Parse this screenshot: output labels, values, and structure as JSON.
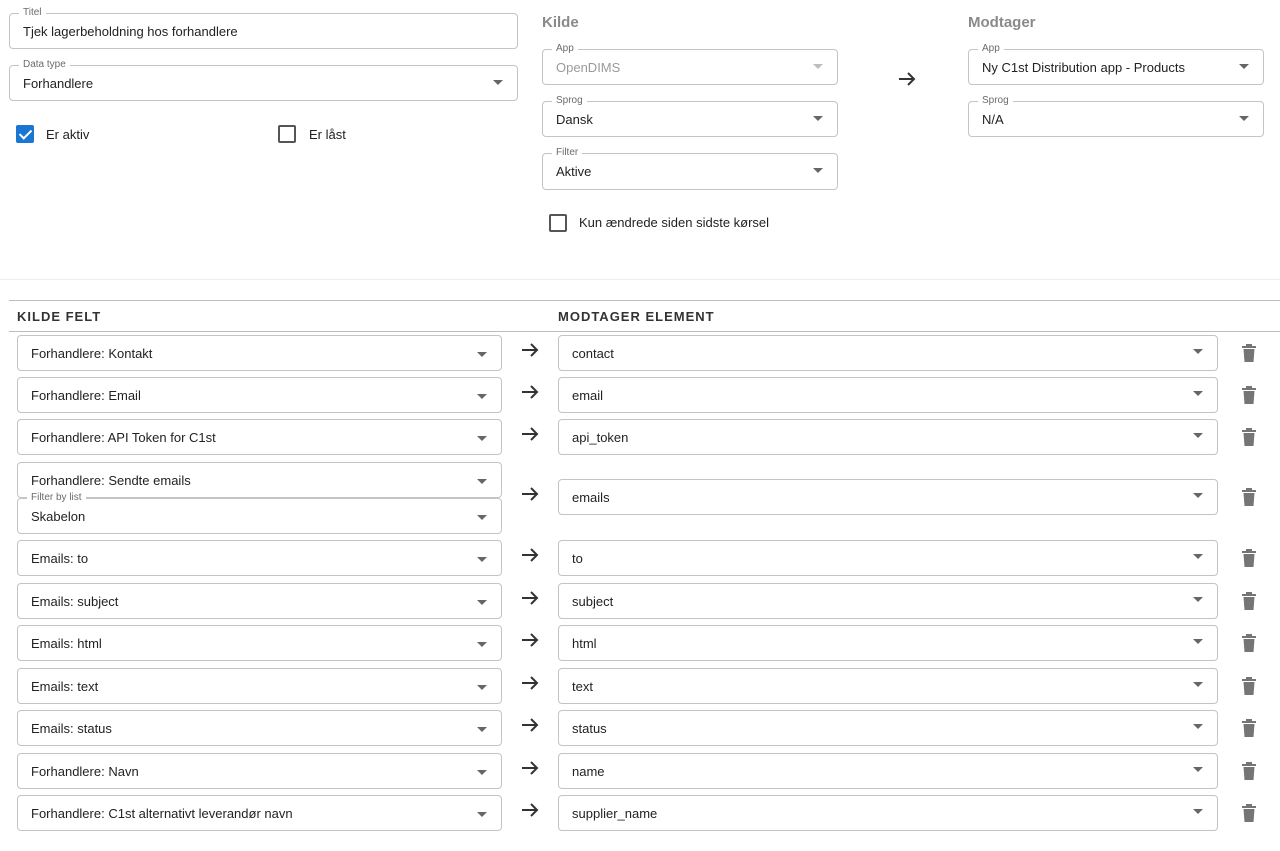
{
  "form": {
    "title_label": "Titel",
    "title_value": "Tjek lagerbeholdning hos forhandlere",
    "datatype_label": "Data type",
    "datatype_value": "Forhandlere",
    "active_label": "Er aktiv",
    "active_checked": true,
    "locked_label": "Er låst",
    "locked_checked": false
  },
  "source": {
    "heading": "Kilde",
    "app_label": "App",
    "app_value": "OpenDIMS",
    "lang_label": "Sprog",
    "lang_value": "Dansk",
    "filter_label": "Filter",
    "filter_value": "Aktive",
    "changed_only_label": "Kun ændrede siden sidste kørsel",
    "changed_only_checked": false
  },
  "receiver": {
    "heading": "Modtager",
    "app_label": "App",
    "app_value": "Ny C1st Distribution app - Products",
    "lang_label": "Sprog",
    "lang_value": "N/A"
  },
  "mapping": {
    "source_header": "KILDE FELT",
    "target_header": "MODTAGER ELEMENT",
    "filter_by_list_label": "Filter by list",
    "filter_by_list_value": "Skabelon",
    "rows": [
      {
        "source": "Forhandlere: Kontakt",
        "target": "contact"
      },
      {
        "source": "Forhandlere: Email",
        "target": "email"
      },
      {
        "source": "Forhandlere: API Token for C1st",
        "target": "api_token"
      },
      {
        "source": "Forhandlere: Sendte emails",
        "target": "emails"
      },
      {
        "source": "Emails: to",
        "target": "to"
      },
      {
        "source": "Emails: subject",
        "target": "subject"
      },
      {
        "source": "Emails: html",
        "target": "html"
      },
      {
        "source": "Emails: text",
        "target": "text"
      },
      {
        "source": "Emails: status",
        "target": "status"
      },
      {
        "source": "Forhandlere: Navn",
        "target": "name"
      },
      {
        "source": "Forhandlere: C1st alternativt leverandør navn",
        "target": "supplier_name"
      }
    ]
  },
  "colors": {
    "accent": "#1976d2",
    "section_title": "#8a8a8a",
    "border": "#c4c4c4",
    "icon": "#757575"
  }
}
